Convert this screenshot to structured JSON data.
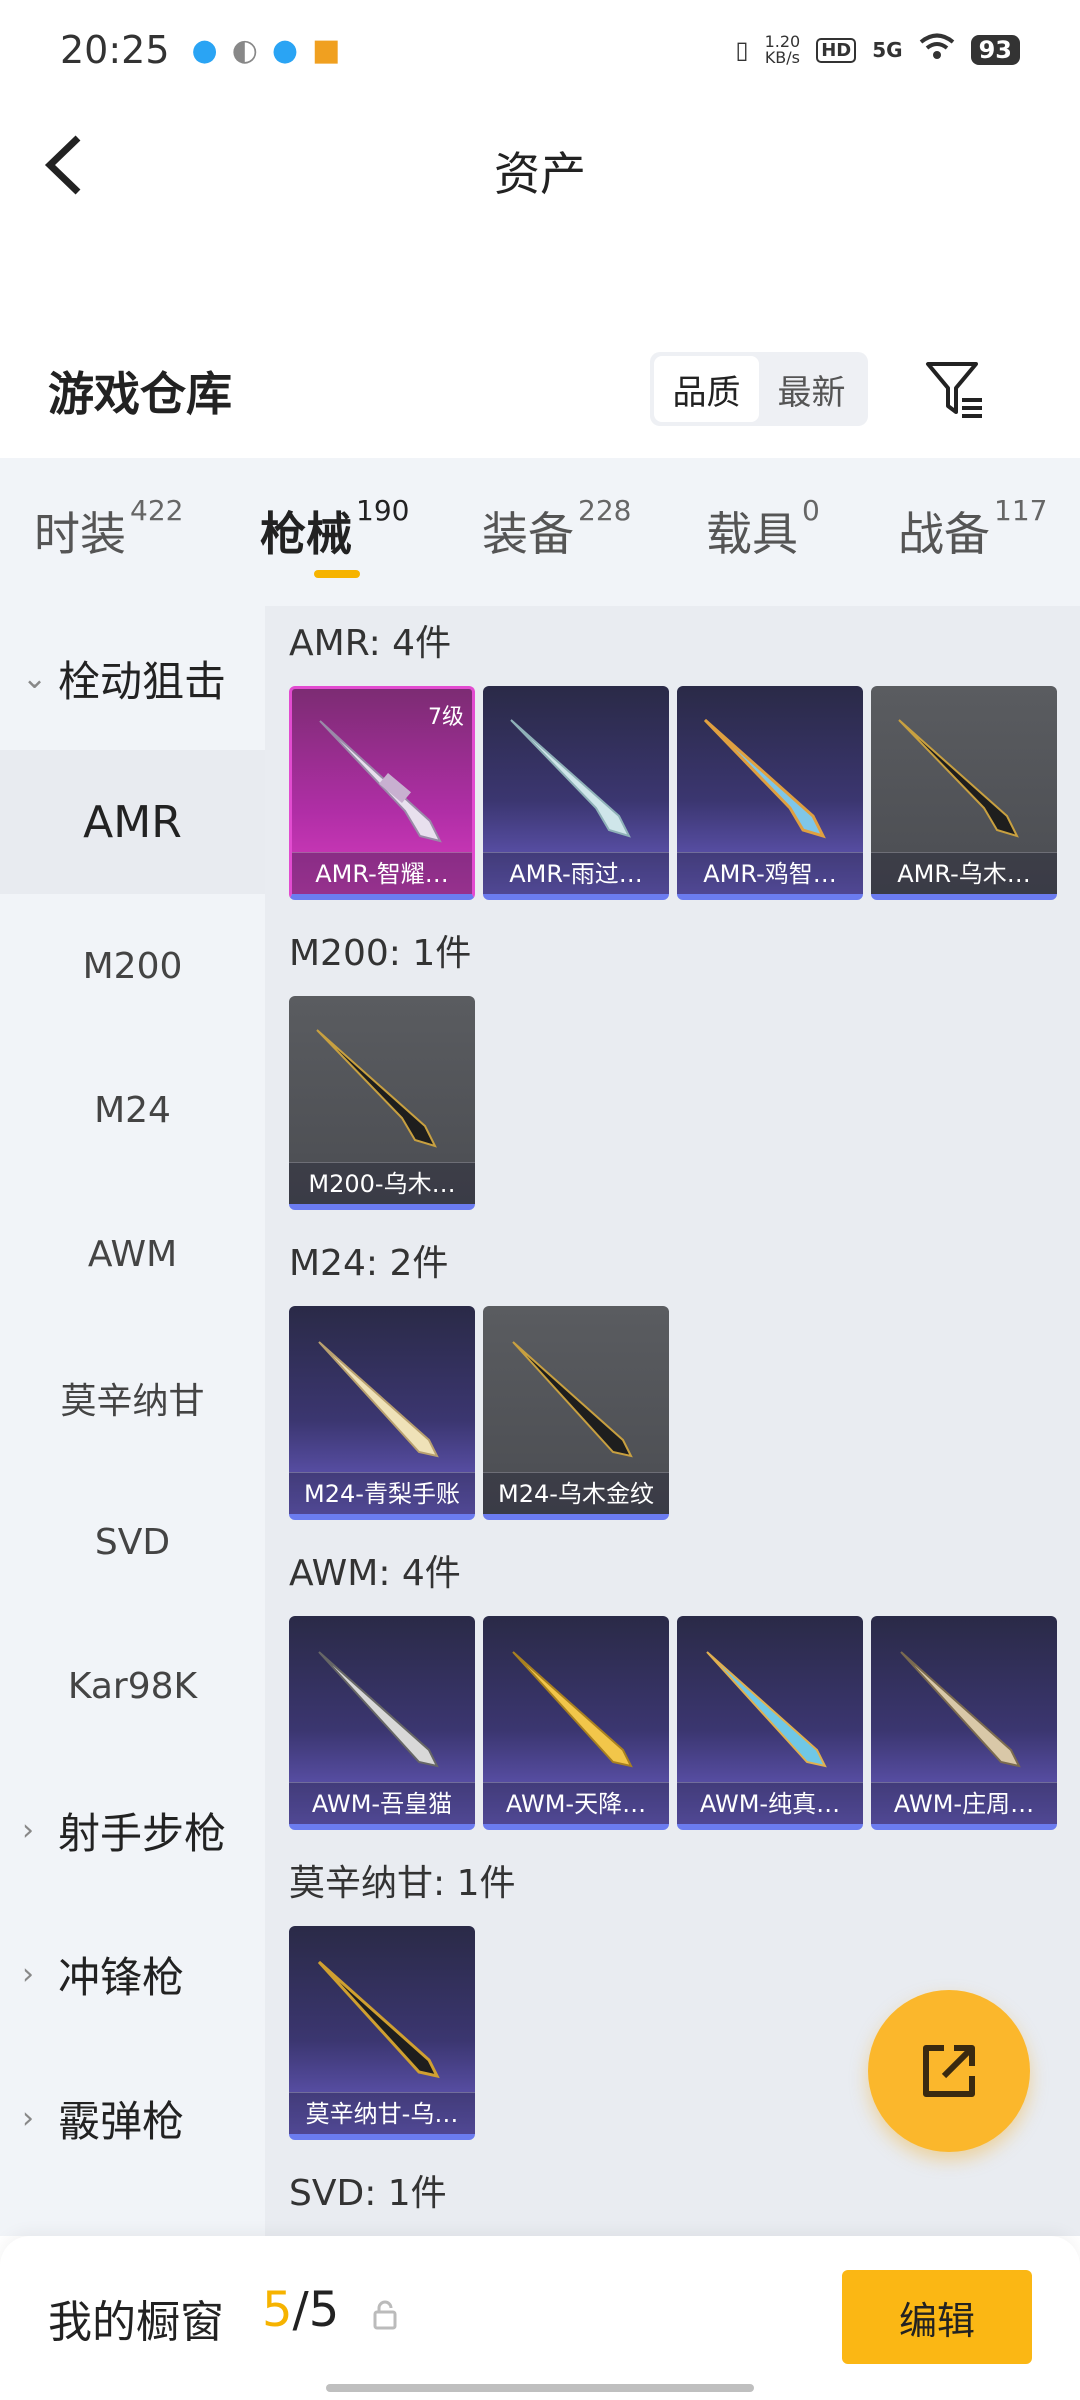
{
  "status_bar": {
    "time": "20:25",
    "net_speed_value": "1.20",
    "net_speed_unit": "KB/s",
    "hd_badge": "HD",
    "network": "5G",
    "battery": "93"
  },
  "header": {
    "back_icon": "chevron-left-icon",
    "title": "资产"
  },
  "warehouse": {
    "title": "游戏仓库",
    "sort_options": [
      "品质",
      "最新"
    ],
    "sort_selected": "品质",
    "filter_icon": "filter-icon"
  },
  "tabs": [
    {
      "label": "时装",
      "count": "422"
    },
    {
      "label": "枪械",
      "count": "190",
      "active": true
    },
    {
      "label": "装备",
      "count": "228"
    },
    {
      "label": "载具",
      "count": "0"
    },
    {
      "label": "战备",
      "count": "117"
    }
  ],
  "sidebar": {
    "group_open": "栓动狙击",
    "items": [
      "AMR",
      "M200",
      "M24",
      "AWM",
      "莫辛纳甘",
      "SVD",
      "Kar98K"
    ],
    "active_item": "AMR",
    "groups_closed": [
      "射手步枪",
      "冲锋枪",
      "霰弹枪"
    ]
  },
  "sections": [
    {
      "title": "AMR: 4件",
      "items": [
        {
          "name": "AMR-智耀…",
          "level": "7级",
          "style": "pink"
        },
        {
          "name": "AMR-雨过…",
          "style": "purple"
        },
        {
          "name": "AMR-鸡智…",
          "style": "purple"
        },
        {
          "name": "AMR-乌木…",
          "style": "grey"
        }
      ]
    },
    {
      "title": "M200: 1件",
      "items": [
        {
          "name": "M200-乌木…",
          "style": "grey"
        }
      ]
    },
    {
      "title": "M24: 2件",
      "items": [
        {
          "name": "M24-青梨手账",
          "style": "purple"
        },
        {
          "name": "M24-乌木金纹",
          "style": "grey"
        }
      ]
    },
    {
      "title": "AWM: 4件",
      "items": [
        {
          "name": "AWM-吾皇猫",
          "style": "purple"
        },
        {
          "name": "AWM-天降…",
          "style": "purple"
        },
        {
          "name": "AWM-纯真…",
          "style": "purple"
        },
        {
          "name": "AWM-庄周…",
          "style": "purple"
        }
      ]
    },
    {
      "title": "莫辛纳甘: 1件",
      "items": [
        {
          "name": "莫辛纳甘-乌…",
          "style": "purple"
        }
      ]
    },
    {
      "title": "SVD: 1件",
      "items": []
    }
  ],
  "fab": {
    "icon": "share-external-icon"
  },
  "showcase": {
    "title": "我的橱窗",
    "count_current": "5",
    "count_sep": "/",
    "count_total": "5",
    "edit_label": "编辑"
  },
  "colors": {
    "accent": "#f6b300",
    "tab_bg": "#f1f4f8",
    "content_bg": "#e9ecf1"
  }
}
